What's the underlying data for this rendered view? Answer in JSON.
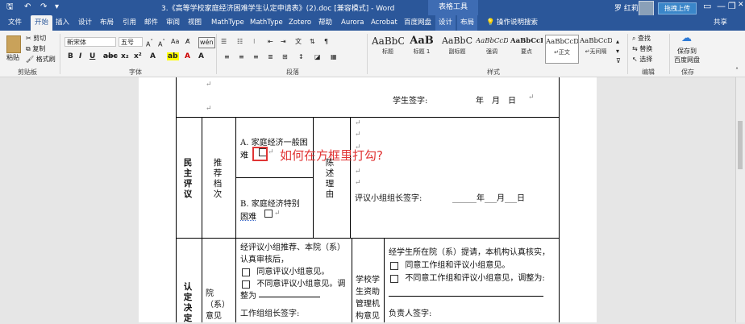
{
  "titlebar": {
    "doc_title": "3.《高等学校家庭经济困难学生认定申请表》(2).doc [兼容模式] - Word",
    "context_group": "表格工具",
    "user": "罗 红莉",
    "cloud_button": "拖拽上传",
    "minimize": "—",
    "restore": "❐",
    "close": "✕",
    "options": "▭"
  },
  "tabs": [
    "文件",
    "开始",
    "插入",
    "设计",
    "布局",
    "引用",
    "邮件",
    "审阅",
    "视图",
    "MathType",
    "MathType",
    "Zotero",
    "帮助",
    "Aurora",
    "Acrobat",
    "百度网盘",
    "设计",
    "布局"
  ],
  "tell_me": "操作说明搜索",
  "share": "共享",
  "ribbon": {
    "clipboard": {
      "paste": "粘贴",
      "cut": "剪切",
      "copy": "复制",
      "format_painter": "格式刷",
      "label": "剪贴板"
    },
    "font": {
      "name": "新宋体",
      "size": "五号",
      "label": "字体"
    },
    "paragraph": {
      "label": "段落"
    },
    "styles": {
      "label": "样式",
      "items": [
        {
          "sample": "AaBbC",
          "name": "标题"
        },
        {
          "sample": "AaB",
          "name": "标题 1"
        },
        {
          "sample": "AaBbC",
          "name": "副标题"
        },
        {
          "sample": "AaBbCcD",
          "name": "强调"
        },
        {
          "sample": "AaBbCcD",
          "name": "要点"
        },
        {
          "sample": "AaBbCcD",
          "name": "↵正文"
        },
        {
          "sample": "AaBbCcD",
          "name": "↵无间隔"
        }
      ]
    },
    "editing": {
      "find": "查找",
      "replace": "替换",
      "select": "选择",
      "label": "编辑"
    },
    "save": {
      "line1": "保存到",
      "line2": "百度网盘",
      "label": "保存"
    }
  },
  "document": {
    "student_sign": "学生签字:",
    "date_fmt": "年　月　日",
    "minzhu_pingyi": "民主评议",
    "tuijian_dangci": "推荐档次",
    "option_a_line1": "A. 家庭经济一般困",
    "option_a_line2": "难",
    "option_b_line1": "B. 家庭经济特别",
    "option_b_line2": "困难",
    "chenshu_liyou": "陈述理由",
    "group_leader_sign": "评议小组组长签字:",
    "date_blanks": "______年___月___日",
    "rending_jueding": "认定决定",
    "yuanxi_yijian": "院（系）意见",
    "yuanxi_text1": "经评议小组推荐、本院（系）",
    "yuanxi_text2": "认真审核后，",
    "yuanxi_opt1": "同意评议小组意见。",
    "yuanxi_opt2": "不同意评议小组意见。调",
    "yuanxi_adjust": "整为",
    "work_group_sign": "工作组组长签字:",
    "xuexiao_text": "学校学生资助管理机构意见",
    "school_text1": "经学生所在院（系）提请，本机构认真核实，",
    "school_opt1": "同意工作组和评议小组意见。",
    "school_opt2": "不同意工作组和评议小组意见，调整为:",
    "responsible_sign": "负责人签字:",
    "para_mark": "↵"
  },
  "annotation": "如何在方框里打勾?"
}
